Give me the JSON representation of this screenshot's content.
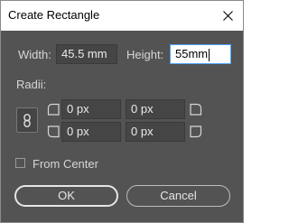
{
  "window": {
    "title": "Create Rectangle"
  },
  "size": {
    "width_label": "Width:",
    "width_value": "45.5 mm",
    "height_label": "Height:",
    "height_value": "55mm"
  },
  "radii": {
    "label": "Radii:",
    "top_left": "0 px",
    "top_right": "0 px",
    "bottom_left": "0 px",
    "bottom_right": "0 px"
  },
  "options": {
    "from_center_label": "From Center",
    "from_center_checked": false
  },
  "buttons": {
    "ok_label": "OK",
    "cancel_label": "Cancel"
  },
  "colors": {
    "dialog_bg": "#535353",
    "field_bg": "#454545",
    "focus_border": "#4aa3ff"
  }
}
